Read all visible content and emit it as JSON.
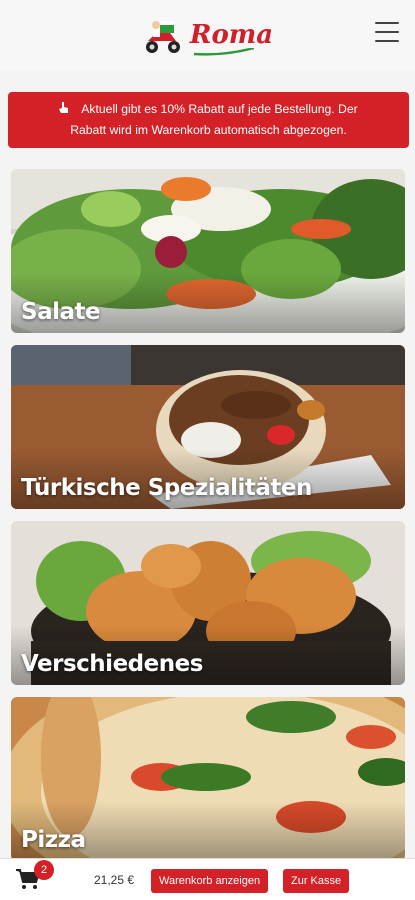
{
  "header": {
    "logo_text": "Roma",
    "menu_icon": "hamburger-menu-icon"
  },
  "banner": {
    "icon": "pointing-hand-icon",
    "line1": "Aktuell gibt es 10% Rabatt auf jede Bestellung. Der",
    "line2": "Rabatt wird im Warenkorb automatisch abgezogen."
  },
  "categories": [
    {
      "label": "Salate"
    },
    {
      "label": "Türkische Spezialitäten"
    },
    {
      "label": "Verschiedenes"
    },
    {
      "label": "Pizza"
    }
  ],
  "cart": {
    "icon": "shopping-cart-icon",
    "count": "2",
    "total": "21,25 €",
    "show_cart_label": "Warenkorb anzeigen",
    "checkout_label": "Zur Kasse"
  },
  "colors": {
    "brand_red": "#d42128",
    "logo_green": "#2e9a3a"
  }
}
